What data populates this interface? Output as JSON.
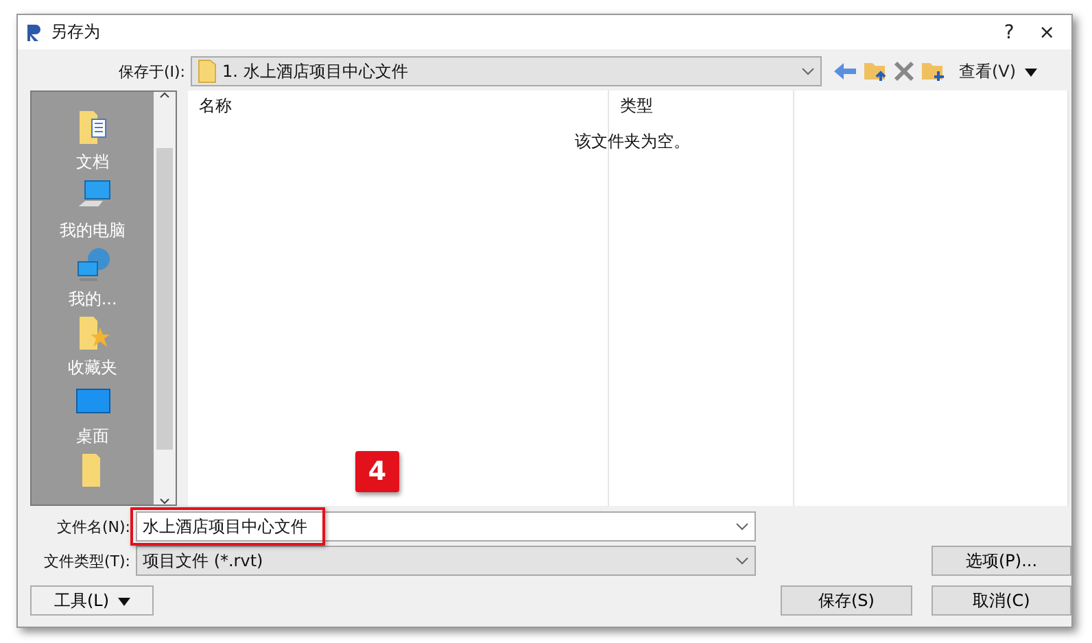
{
  "window": {
    "title": "另存为",
    "help": "?",
    "close": "×"
  },
  "save_in": {
    "label": "保存于(I):",
    "value": "1. 水上酒店项目中心文件",
    "view_label": "查看(V)"
  },
  "sidebar": {
    "items": [
      {
        "kind": "documents",
        "label": "文档"
      },
      {
        "kind": "computer",
        "label": "我的电脑"
      },
      {
        "kind": "network",
        "label": "我的..."
      },
      {
        "kind": "favorites",
        "label": "收藏夹"
      },
      {
        "kind": "desktop",
        "label": "桌面"
      },
      {
        "kind": "folder"
      }
    ]
  },
  "file_list": {
    "columns": [
      "名称",
      "类型"
    ],
    "empty_message": "该文件夹为空。"
  },
  "file_name": {
    "label": "文件名(N):",
    "value": "水上酒店项目中心文件",
    "highlighted": true
  },
  "file_type": {
    "label": "文件类型(T):",
    "value": "项目文件 (*.rvt)"
  },
  "step_badge": "4",
  "buttons": {
    "tools": "工具(L)",
    "options": "选项(P)...",
    "save": "保存(S)",
    "cancel": "取消(C)"
  }
}
